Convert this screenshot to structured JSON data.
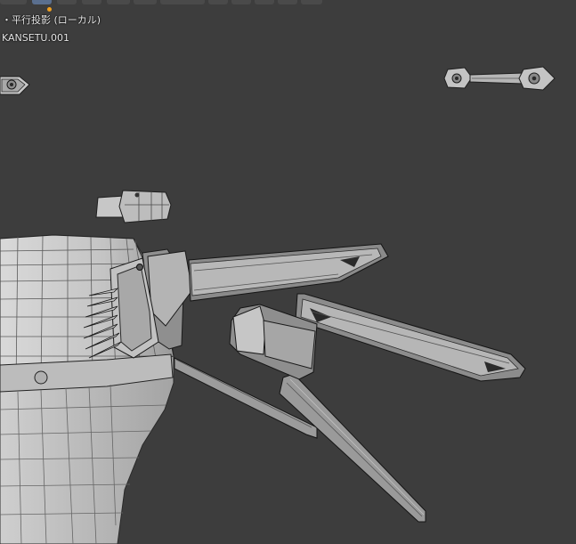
{
  "viewport": {
    "background_color": "#3d3d3d",
    "view_mode_label": "・平行投影 (ローカル)",
    "active_object_name": "KANSETU.001"
  },
  "header": {
    "active_indicator_color": "#f0a020"
  },
  "icons": {
    "active_dot": "orange-dot-icon"
  }
}
